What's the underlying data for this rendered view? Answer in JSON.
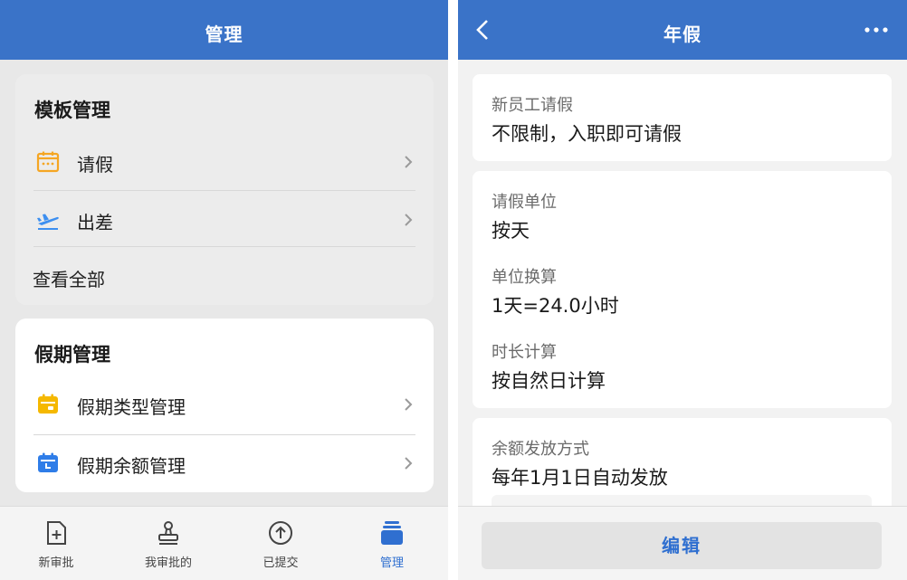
{
  "left": {
    "header": {
      "title": "管理"
    },
    "template_section": {
      "title": "模板管理",
      "items": [
        {
          "label": "请假",
          "icon": "calendar-icon",
          "color": "#f5a623"
        },
        {
          "label": "出差",
          "icon": "airplane-takeoff-icon",
          "color": "#3d8ff0"
        }
      ],
      "view_all": "查看全部"
    },
    "holiday_section": {
      "title": "假期管理",
      "items": [
        {
          "label": "假期类型管理",
          "icon": "calendar-filled-icon",
          "color": "#f5b800"
        },
        {
          "label": "假期余额管理",
          "icon": "calendar-clock-icon",
          "color": "#2f7de8"
        }
      ]
    },
    "tabbar": {
      "tabs": [
        {
          "label": "新审批",
          "icon": "new-document-icon"
        },
        {
          "label": "我审批的",
          "icon": "stamp-icon"
        },
        {
          "label": "已提交",
          "icon": "upload-circle-icon"
        },
        {
          "label": "管理",
          "icon": "stack-icon",
          "active": true
        }
      ]
    }
  },
  "right": {
    "header": {
      "title": "年假"
    },
    "cards": {
      "new_employee": {
        "label": "新员工请假",
        "value": "不限制，入职即可请假"
      },
      "unit": {
        "label": "请假单位",
        "value": "按天"
      },
      "conversion": {
        "label": "单位换算",
        "value": "1天=24.0小时"
      },
      "duration": {
        "label": "时长计算",
        "value": "按自然日计算"
      },
      "balance": {
        "label": "余额发放方式",
        "value": "每年1月1日自动发放"
      }
    },
    "edit_label": "编辑"
  },
  "colors": {
    "brand": "#3a73c8",
    "active_tab": "#2f6fd0"
  }
}
